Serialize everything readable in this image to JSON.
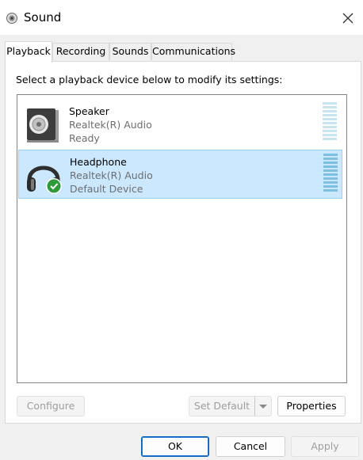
{
  "window": {
    "title": "Sound",
    "icons": {
      "app": "speaker-icon",
      "close": "close-icon"
    }
  },
  "tabs": [
    {
      "label": "Playback",
      "active": true
    },
    {
      "label": "Recording",
      "active": false
    },
    {
      "label": "Sounds",
      "active": false
    },
    {
      "label": "Communications",
      "active": false
    }
  ],
  "playback": {
    "instruction": "Select a playback device below to modify its settings:",
    "devices": [
      {
        "name": "Speaker",
        "driver": "Realtek(R) Audio",
        "status": "Ready",
        "icon": "speaker-device-icon",
        "selected": false,
        "default": false
      },
      {
        "name": "Headphone",
        "driver": "Realtek(R) Audio",
        "status": "Default Device",
        "icon": "headphone-device-icon",
        "selected": true,
        "default": true
      }
    ]
  },
  "buttons": {
    "configure": "Configure",
    "set_default": "Set Default",
    "properties": "Properties",
    "ok": "OK",
    "cancel": "Cancel",
    "apply": "Apply"
  },
  "colors": {
    "selection_bg": "#cce8ff",
    "selection_border": "#99d1ff",
    "default_check": "#2e9a3a",
    "meter_idle": "#c8e4ef",
    "meter_selected": "#7fbfdf"
  }
}
